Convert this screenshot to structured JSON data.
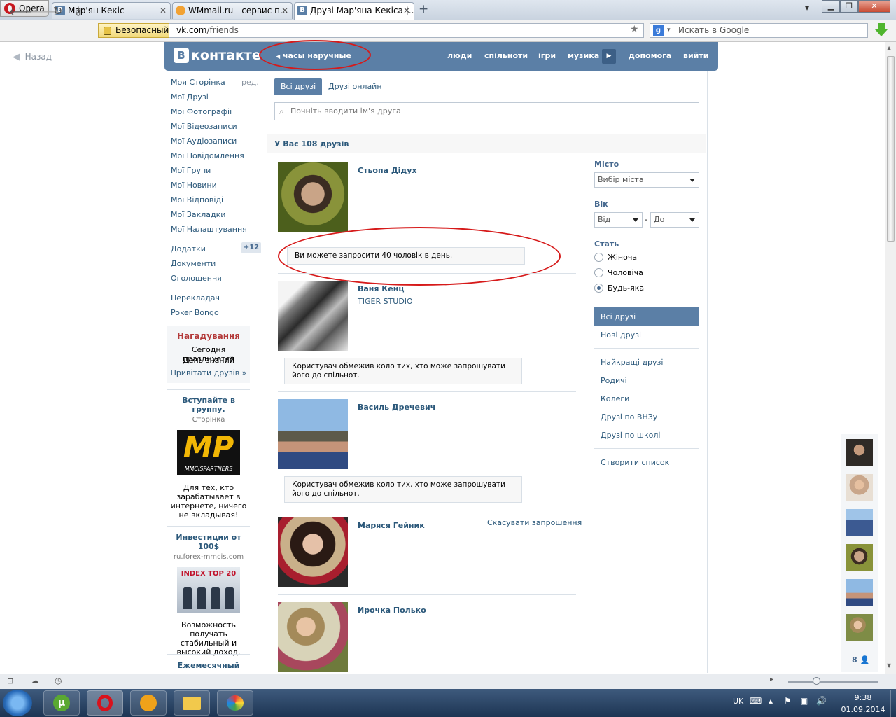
{
  "browser": {
    "opera_label": "Opera",
    "tabs": [
      {
        "label": "Мар'ян Кекіс",
        "icon": "vk"
      },
      {
        "label": "WMmail.ru - сервис п...",
        "icon": "wmmail"
      },
      {
        "label": "Друзі Мар'яна Кекіса |...",
        "icon": "vk"
      }
    ],
    "new_tab": "+",
    "secure_label": "Безопасный",
    "url_host": "vk.com",
    "url_path": "/friends",
    "search_placeholder": "Искать в Google"
  },
  "vk": {
    "back_label": "Назад",
    "logo_text": "контакте",
    "logo_b": "В",
    "status_text": "часы наручные",
    "top_menu": [
      "люди",
      "спільноти",
      "ігри",
      "музика",
      "допомога",
      "вийти"
    ],
    "edit_label": "ред.",
    "side_menu": [
      "Моя Сторінка",
      "Мої Друзі",
      "Мої Фотографії",
      "Мої Відеозаписи",
      "Мої Аудіозаписи",
      "Мої Повідомлення",
      "Мої Групи",
      "Мої Новини",
      "Мої Відповіді",
      "Мої Закладки",
      "Мої Налаштування"
    ],
    "side_menu2": [
      "Додатки",
      "Документи",
      "Оголошення"
    ],
    "apps_badge": "+12",
    "side_menu3": [
      "Перекладач",
      "Poker Bongo"
    ],
    "reminder": {
      "title": "Нагадування",
      "line1": "Сегодня празднуется",
      "line2": "День знаний",
      "link": "Привітати друзів »"
    },
    "ad1": {
      "title": "Вступайте в группу.",
      "sub": "Сторінка",
      "logo": "MP",
      "logo_sub": "MMCISPARTNERS",
      "text": "Для тех, кто зарабатывает в интернете, ничего не вкладывая!"
    },
    "ad2": {
      "title": "Инвестиции от 100$",
      "sub": "ru.forex-mmcis.com",
      "logo": "INDEX TOP 20",
      "text": "Возможность получать стабильный и высокий доход."
    },
    "ad3": {
      "title": "Ежемесячный"
    },
    "tabs": [
      "Всі друзі",
      "Друзі онлайн"
    ],
    "search_placeholder": "Почніть вводити ім'я друга",
    "friends_count_label": "У Вас 108 друзів",
    "friends": [
      {
        "name": "Стьопа Дідух",
        "sub": "",
        "notice": "Ви можете запросити 40 чоловік в день.",
        "action": ""
      },
      {
        "name": "Ваня Кенц",
        "sub": "TIGER STUDIO",
        "notice": "Користувач обмежив коло тих, хто може запрошувати його до спільнот.",
        "action": ""
      },
      {
        "name": "Василь Дречевич",
        "sub": "",
        "notice": "Користувач обмежив коло тих, хто може запрошувати його до спільнот.",
        "action": ""
      },
      {
        "name": "Маряся Гейник",
        "sub": "",
        "notice": "",
        "action": "Скасувати запрошення"
      },
      {
        "name": "Ирочка Полько",
        "sub": "",
        "notice": "",
        "action": ""
      }
    ],
    "filters": {
      "city_label": "Місто",
      "city_select": "Вибір міста",
      "age_label": "Вік",
      "age_from": "Від",
      "age_dash": "-",
      "age_to": "До",
      "sex_label": "Стать",
      "sex_options": [
        "Жіноча",
        "Чоловіча",
        "Будь-яка"
      ],
      "sex_selected": 2,
      "lists": [
        "Всі друзі",
        "Нові друзі"
      ],
      "lists2": [
        "Найкращі друзі",
        "Родичі",
        "Колеги",
        "Друзі по ВНЗу",
        "Друзі по школі"
      ],
      "create_list": "Створити список"
    },
    "online_count": "8"
  },
  "taskbar": {
    "lang": "UK",
    "time": "9:38",
    "date": "01.09.2014"
  },
  "colors": {
    "vk_blue": "#5b7fa6",
    "link": "#2b587a",
    "annotation_red": "#d61a1a"
  }
}
